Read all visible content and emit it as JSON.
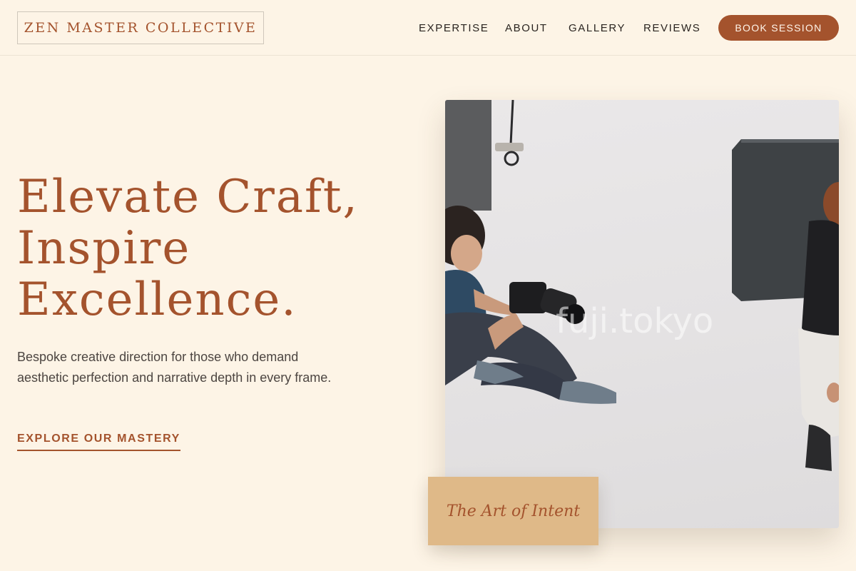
{
  "header": {
    "logo": "ZEN MASTER COLLECTIVE",
    "nav": [
      "EXPERTISE",
      "ABOUT",
      "GALLERY",
      "REVIEWS"
    ],
    "cta": "BOOK SESSION"
  },
  "hero": {
    "title_lines": [
      "Elevate Craft,",
      "Inspire",
      "Excellence."
    ],
    "description": "Bespoke creative direction for those who demand aesthetic perfection and narrative depth in every frame.",
    "cta": "EXPLORE OUR MASTERY",
    "image_watermark": "fuji.tokyo",
    "caption": "The Art of Intent"
  },
  "colors": {
    "background": "#fdf4e6",
    "accent": "#a4532d",
    "caption_card": "#dfb988"
  }
}
